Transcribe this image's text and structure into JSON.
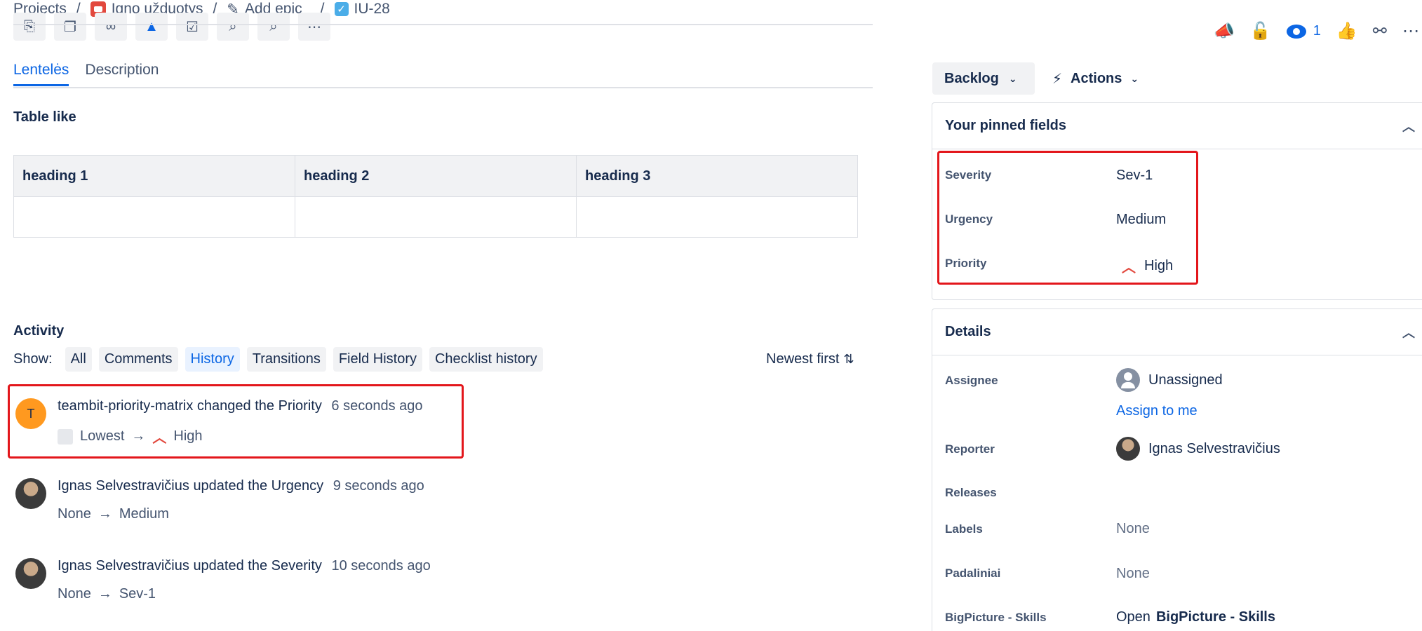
{
  "breadcrumb": {
    "projects": "Projects",
    "project": "Igno užduotys",
    "epic": "Add epic",
    "issue": "IU-28",
    "sep": "/"
  },
  "toolbar": {
    "icons": [
      "paperclip-icon",
      "copy-icon",
      "link-icon",
      "bird-icon",
      "checklist-icon",
      "search-doc-icon",
      "search-icon",
      "more-icon"
    ]
  },
  "tabs": [
    {
      "label": "Lentelės",
      "active": true
    },
    {
      "label": "Description",
      "active": false
    }
  ],
  "table": {
    "title": "Table like",
    "headers": [
      "heading 1",
      "heading 2",
      "heading 3"
    ]
  },
  "activity": {
    "title": "Activity",
    "show_label": "Show:",
    "filters": [
      "All",
      "Comments",
      "History",
      "Transitions",
      "Field History",
      "Checklist history"
    ],
    "active_filter": "History",
    "sort_label": "Newest first",
    "items": [
      {
        "avatar_letter": "T",
        "actor": "teambit-priority-matrix",
        "verb": "changed the",
        "field": "Priority",
        "time": "6 seconds ago",
        "from": "Lowest",
        "to": "High"
      },
      {
        "actor": "Ignas Selvestravičius",
        "verb": "updated the",
        "field": "Urgency",
        "time": "9 seconds ago",
        "from": "None",
        "to": "Medium"
      },
      {
        "actor": "Ignas Selvestravičius",
        "verb": "updated the",
        "field": "Severity",
        "time": "10 seconds ago",
        "from": "None",
        "to": "Sev-1"
      }
    ]
  },
  "header_actions": {
    "watch_count": "1",
    "icons": [
      "megaphone-icon",
      "lock-icon",
      "watch-icon",
      "thumbs-up-icon",
      "share-icon",
      "more-icon"
    ]
  },
  "status": {
    "label": "Backlog",
    "actions_label": "Actions"
  },
  "pinned": {
    "title": "Your pinned fields",
    "fields": [
      {
        "label": "Severity",
        "value": "Sev-1"
      },
      {
        "label": "Urgency",
        "value": "Medium"
      },
      {
        "label": "Priority",
        "value": "High"
      }
    ]
  },
  "details": {
    "title": "Details",
    "assignee_label": "Assignee",
    "assignee_value": "Unassigned",
    "assign_to_me": "Assign to me",
    "reporter_label": "Reporter",
    "reporter_value": "Ignas Selvestravičius",
    "releases_label": "Releases",
    "labels_label": "Labels",
    "labels_value": "None",
    "padaliniai_label": "Padaliniai",
    "padaliniai_value": "None",
    "bigpicture_label": "BigPicture - Skills",
    "bigpicture_open": "Open",
    "bigpicture_value": "BigPicture - Skills"
  },
  "colors": {
    "accent": "#0c66e4",
    "highlight_box": "#e3161b",
    "priority_high": "#e2483d"
  }
}
